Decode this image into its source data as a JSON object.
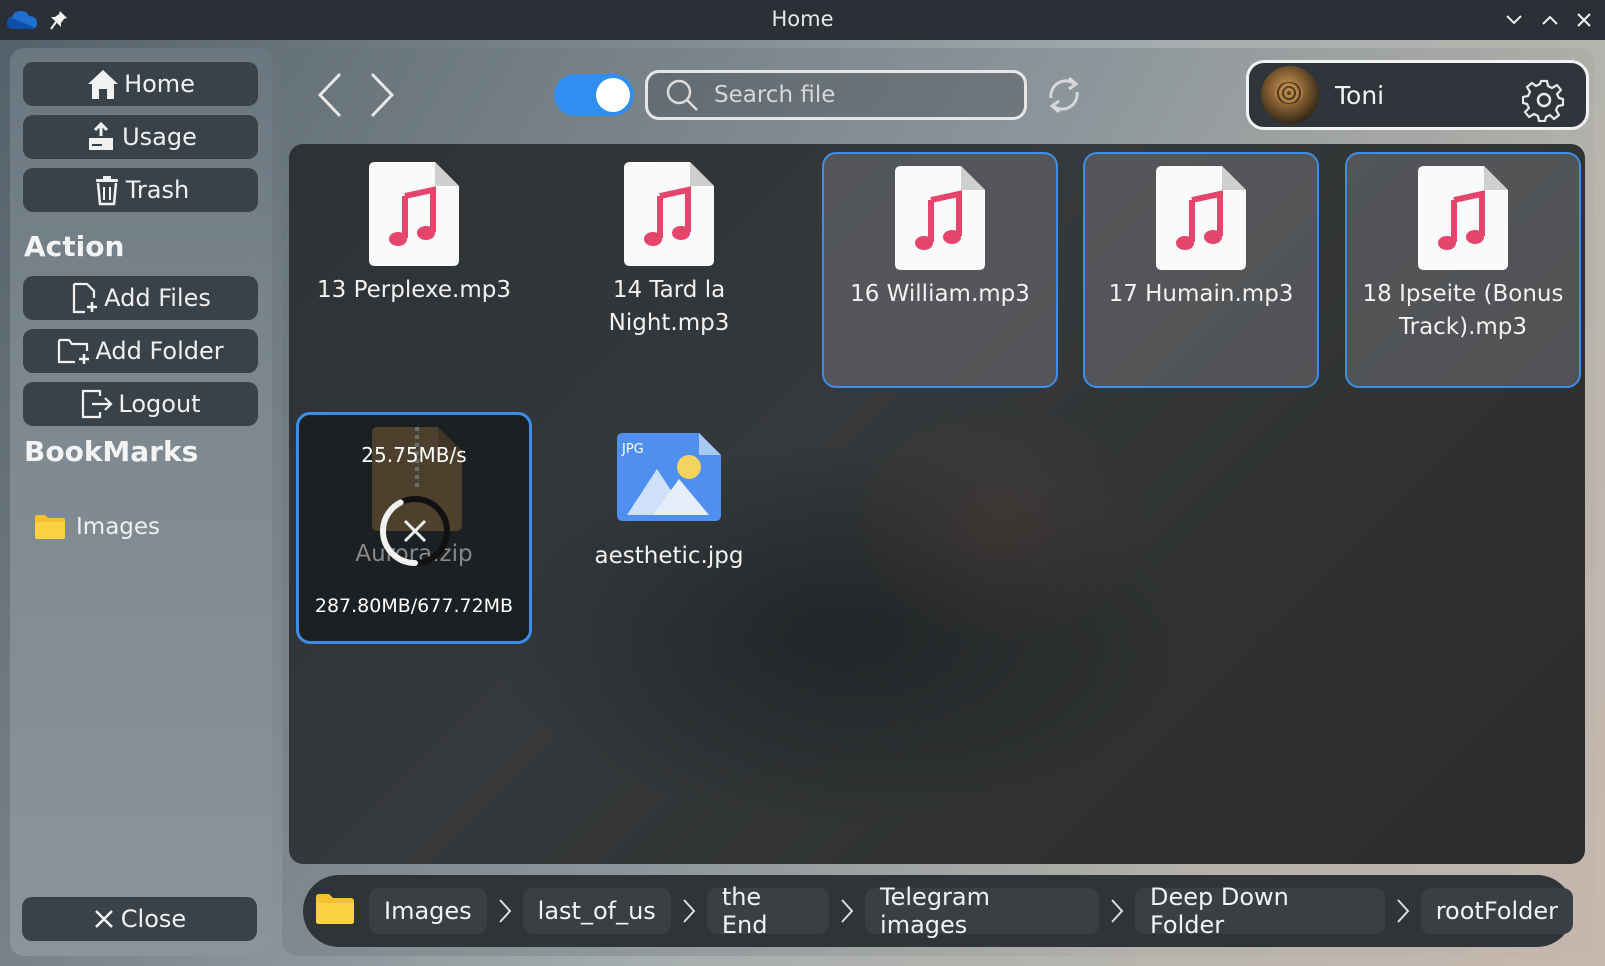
{
  "window": {
    "title": "Home"
  },
  "sidebar": {
    "nav": [
      {
        "label": "Home"
      },
      {
        "label": "Usage"
      },
      {
        "label": "Trash"
      }
    ],
    "action_heading": "Action",
    "actions": [
      {
        "label": "Add Files"
      },
      {
        "label": "Add Folder"
      },
      {
        "label": "Logout"
      }
    ],
    "bookmarks_heading": "BookMarks",
    "bookmarks": [
      {
        "label": "Images"
      }
    ],
    "close_label": "Close"
  },
  "toolbar": {
    "search_placeholder": "Search file",
    "toggle_on": true,
    "user_name": "Toni"
  },
  "files": [
    {
      "name": "13  Perplexe.mp3",
      "type": "audio",
      "selected": false
    },
    {
      "name": "14  Tard la Night.mp3",
      "type": "audio",
      "selected": false
    },
    {
      "name": "16  William.mp3",
      "type": "audio",
      "selected": true
    },
    {
      "name": "17  Humain.mp3",
      "type": "audio",
      "selected": true
    },
    {
      "name": "18 Ipseite (Bonus Track).mp3",
      "type": "audio",
      "selected": true
    }
  ],
  "download": {
    "name": "Aurora.zip",
    "speed": "25.75MB/s",
    "progress_text": "287.80MB/677.72MB",
    "progress_fraction": 0.425
  },
  "image_file": {
    "name": "aesthetic.jpg",
    "badge": "JPG"
  },
  "breadcrumb": [
    "Images",
    "last_of_us",
    "the End",
    "Telegram images",
    "Deep Down Folder",
    "rootFolder"
  ],
  "colors": {
    "accent": "#3d8ee8",
    "music_icon": "#e6456b",
    "folder": "#f5c22f"
  }
}
